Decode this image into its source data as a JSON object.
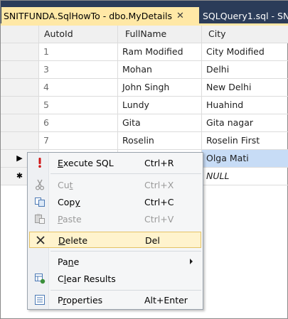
{
  "tabs": [
    {
      "title": "SNITFUNDA.SqlHowTo - dbo.MyDetails",
      "active": true,
      "close_glyph": "✕"
    },
    {
      "title": "SQLQuery1.sql - SN",
      "active": false
    }
  ],
  "grid": {
    "columns": [
      "AutoId",
      "FullName",
      "City"
    ],
    "rows": [
      {
        "marker": "",
        "autoid": "1",
        "fullname": "Ram Modified",
        "city": "City Modified"
      },
      {
        "marker": "",
        "autoid": "3",
        "fullname": "Mohan",
        "city": "Delhi"
      },
      {
        "marker": "",
        "autoid": "4",
        "fullname": "John Singh",
        "city": "New Delhi"
      },
      {
        "marker": "",
        "autoid": "5",
        "fullname": "Lundy",
        "city": "Huahind"
      },
      {
        "marker": "",
        "autoid": "6",
        "fullname": "Gita",
        "city": "Gita nagar"
      },
      {
        "marker": "",
        "autoid": "7",
        "fullname": "Roselin",
        "city": "Roselin First"
      },
      {
        "marker": "▶",
        "autoid": "",
        "fullname": "",
        "city": "Olga Mati"
      },
      {
        "marker": "✱",
        "autoid": "",
        "fullname": "",
        "city": "NULL"
      }
    ]
  },
  "context_menu": {
    "items": [
      {
        "icon": "exclamation-icon",
        "pre": "",
        "key": "E",
        "post": "xecute SQL",
        "shortcut": "Ctrl+R",
        "enabled": true
      },
      {
        "icon": "cut-icon",
        "pre": "Cu",
        "key": "t",
        "post": "",
        "shortcut": "Ctrl+X",
        "enabled": false
      },
      {
        "icon": "copy-icon",
        "pre": "Cop",
        "key": "y",
        "post": "",
        "shortcut": "Ctrl+C",
        "enabled": true
      },
      {
        "icon": "paste-icon",
        "pre": "",
        "key": "P",
        "post": "aste",
        "shortcut": "Ctrl+V",
        "enabled": false
      },
      {
        "icon": "delete-icon",
        "pre": "",
        "key": "D",
        "post": "elete",
        "shortcut": "Del",
        "enabled": true,
        "highlighted": true
      },
      {
        "icon": "",
        "pre": "Pa",
        "key": "n",
        "post": "e",
        "shortcut": "",
        "enabled": true,
        "submenu": true
      },
      {
        "icon": "clear-results-icon",
        "pre": "C",
        "key": "l",
        "post": "ear Results",
        "shortcut": "",
        "enabled": true
      },
      {
        "icon": "properties-icon",
        "pre": "P",
        "key": "r",
        "post": "operties",
        "shortcut": "Alt+Enter",
        "enabled": true
      }
    ]
  },
  "colors": {
    "tab_strip": "#2b3c59",
    "active_tab": "#ffe8a6",
    "selected_cell": "#c7dcf6",
    "menu_highlight": "#fff3cd"
  }
}
